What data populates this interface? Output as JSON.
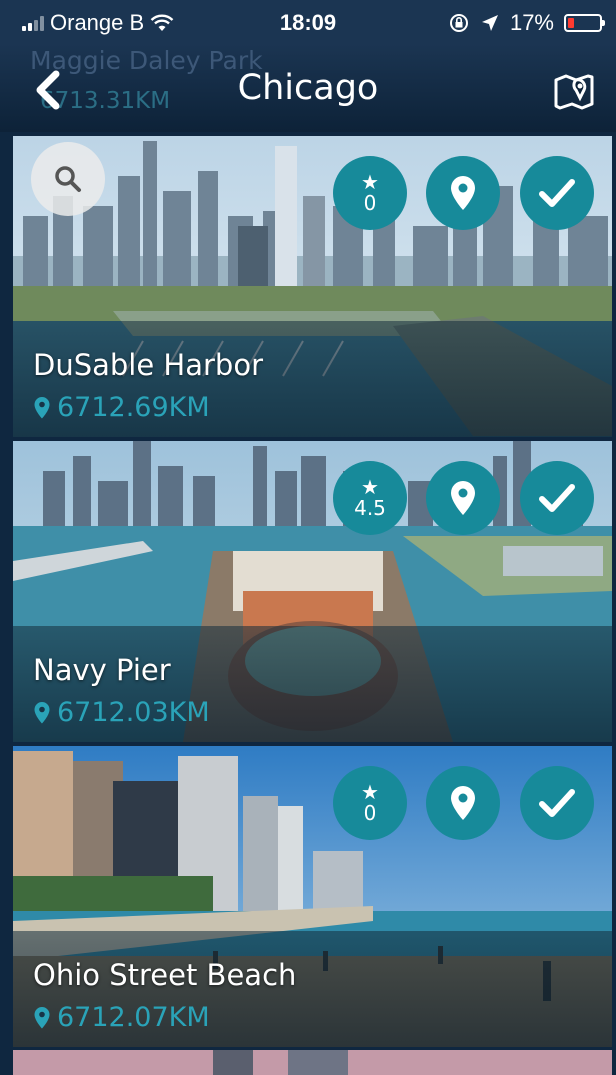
{
  "status_bar": {
    "carrier": "Orange B",
    "time": "18:09",
    "battery": "17%"
  },
  "nav": {
    "title": "Chicago",
    "previous_item_name": "Maggie Daley Park",
    "previous_item_distance": "6713.31KM"
  },
  "places": [
    {
      "name": "DuSable Harbor",
      "distance": "6712.69KM",
      "rating": "0"
    },
    {
      "name": "Navy Pier",
      "distance": "6712.03KM",
      "rating": "4.5"
    },
    {
      "name": "Ohio Street Beach",
      "distance": "6712.07KM",
      "rating": "0"
    }
  ],
  "icons": {
    "back": "chevron-left-icon",
    "map": "map-pin-icon",
    "search": "search-icon",
    "star": "star-icon",
    "location": "location-pin-icon",
    "check": "checkmark-icon",
    "wifi": "wifi-icon",
    "rotation_lock": "rotation-lock-icon",
    "navigation": "navigation-arrow-icon"
  },
  "colors": {
    "accent": "#178a9a",
    "distance_text": "#2aa3b8",
    "nav_background": "#1b3552",
    "battery_low": "#ff3b30"
  }
}
